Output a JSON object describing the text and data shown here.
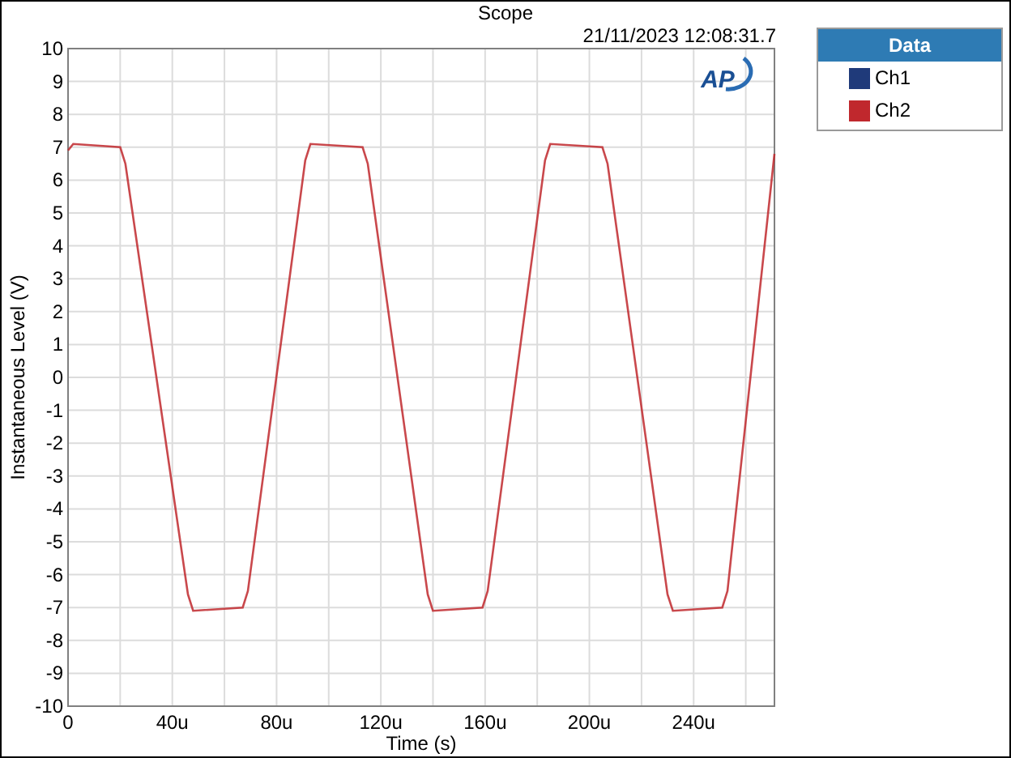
{
  "window": {
    "title": "Scope"
  },
  "timestamp": "21/11/2023 12:08:31.7",
  "logo_text": "AP",
  "legend_title": "Data",
  "chart_data": {
    "type": "line",
    "xlabel": "Time (s)",
    "ylabel": "Instantaneous Level (V)",
    "grid": true,
    "x": [
      0,
      2,
      20,
      22,
      46,
      48,
      67,
      69,
      91,
      93,
      113,
      115,
      138,
      140,
      159,
      161,
      183,
      185,
      205,
      207,
      230,
      232,
      251,
      253,
      271
    ],
    "series": [
      {
        "name": "Ch1",
        "color": "#1f3a7a",
        "values": [
          null,
          null,
          null,
          null,
          null,
          null,
          null,
          null,
          null,
          null,
          null,
          null,
          null,
          null,
          null,
          null,
          null,
          null,
          null,
          null,
          null,
          null,
          null,
          null,
          null
        ]
      },
      {
        "name": "Ch2",
        "color": "#c0282d",
        "values": [
          6.9,
          7.1,
          7.0,
          6.5,
          -6.6,
          -7.1,
          -7.0,
          -6.5,
          6.6,
          7.1,
          7.0,
          6.5,
          -6.6,
          -7.1,
          -7.0,
          -6.5,
          6.6,
          7.1,
          7.0,
          6.5,
          -6.6,
          -7.1,
          -7.0,
          -6.5,
          6.8
        ]
      }
    ],
    "xlim": [
      0,
      271
    ],
    "ylim": [
      -10,
      10
    ],
    "xticks": [
      {
        "value": 0,
        "label": "0"
      },
      {
        "value": 40,
        "label": "40u"
      },
      {
        "value": 80,
        "label": "80u"
      },
      {
        "value": 120,
        "label": "120u"
      },
      {
        "value": 160,
        "label": "160u"
      },
      {
        "value": 200,
        "label": "200u"
      },
      {
        "value": 240,
        "label": "240u"
      }
    ],
    "yticks": [
      -10,
      -9,
      -8,
      -7,
      -6,
      -5,
      -4,
      -3,
      -2,
      -1,
      0,
      1,
      2,
      3,
      4,
      5,
      6,
      7,
      8,
      9,
      10
    ]
  }
}
